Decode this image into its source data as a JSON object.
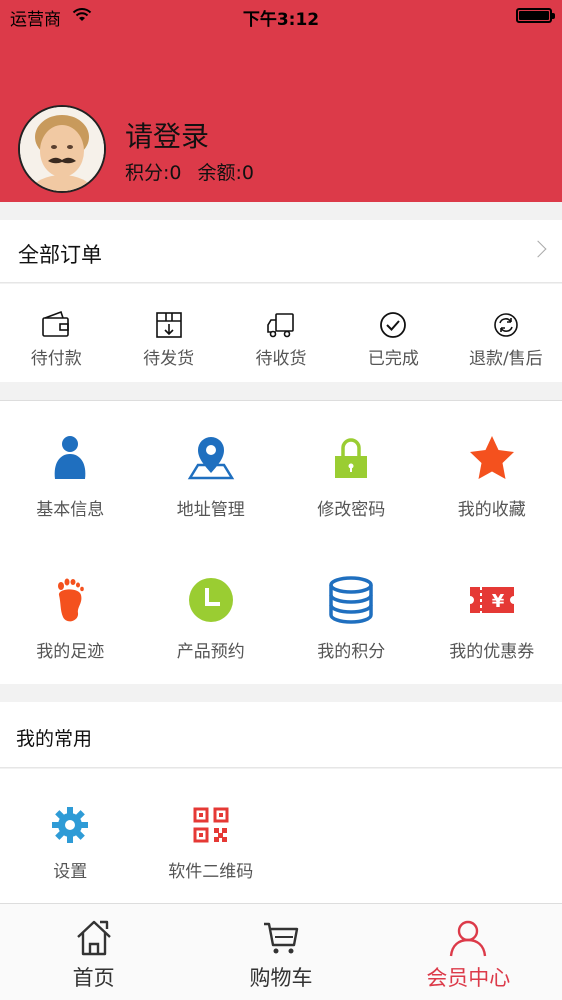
{
  "status_bar": {
    "carrier": "运营商",
    "time": "下午3:12"
  },
  "profile": {
    "name": "请登录",
    "points": "积分:0",
    "balance": "余额:0"
  },
  "orders": {
    "title": "全部订单",
    "items": [
      {
        "label": "待付款",
        "icon": "wallet-icon"
      },
      {
        "label": "待发货",
        "icon": "package-icon"
      },
      {
        "label": "待收货",
        "icon": "truck-icon"
      },
      {
        "label": "已完成",
        "icon": "check-circle-icon"
      },
      {
        "label": "退款/售后",
        "icon": "refund-icon"
      }
    ]
  },
  "menu": {
    "items": [
      {
        "label": "基本信息",
        "icon": "user-profile-icon"
      },
      {
        "label": "地址管理",
        "icon": "location-pin-icon"
      },
      {
        "label": "修改密码",
        "icon": "lock-icon"
      },
      {
        "label": "我的收藏",
        "icon": "star-icon"
      },
      {
        "label": "我的足迹",
        "icon": "footprint-icon"
      },
      {
        "label": "产品预约",
        "icon": "clock-icon"
      },
      {
        "label": "我的积分",
        "icon": "coin-stack-icon"
      },
      {
        "label": "我的优惠券",
        "icon": "coupon-icon"
      }
    ]
  },
  "common": {
    "title": "我的常用",
    "items": [
      {
        "label": "设置",
        "icon": "gear-icon"
      },
      {
        "label": "软件二维码",
        "icon": "qr-code-icon"
      }
    ]
  },
  "tabbar": {
    "items": [
      {
        "label": "首页",
        "icon": "home-icon",
        "active": false
      },
      {
        "label": "购物车",
        "icon": "cart-icon",
        "active": false
      },
      {
        "label": "会员中心",
        "icon": "member-icon",
        "active": true
      }
    ]
  },
  "colors": {
    "brand": "#dc3a49",
    "blue": "#1f6fbf",
    "green": "#9acd32",
    "orange": "#f4511e",
    "red": "#e53935"
  }
}
